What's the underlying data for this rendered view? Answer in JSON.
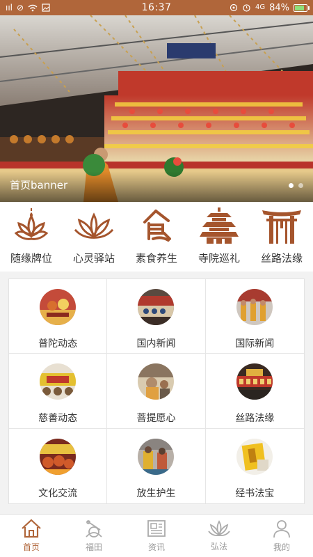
{
  "status_bar": {
    "time": "16:37",
    "signal": "ııl",
    "battery_percent": "84%",
    "battery_level": 0.84,
    "network": "4G"
  },
  "banner": {
    "title": "首页banner",
    "slide_count": 2,
    "active_slide": 0
  },
  "quick_nav": [
    {
      "label": "随缘牌位",
      "icon": "lotus-flame-icon"
    },
    {
      "label": "心灵驿站",
      "icon": "lotus-icon"
    },
    {
      "label": "素食养生",
      "icon": "food-character-icon"
    },
    {
      "label": "寺院巡礼",
      "icon": "pagoda-icon"
    },
    {
      "label": "丝路法缘",
      "icon": "temple-gate-icon"
    }
  ],
  "grid": [
    {
      "label": "普陀动态"
    },
    {
      "label": "国内新闻"
    },
    {
      "label": "国际新闻"
    },
    {
      "label": "慈善动态"
    },
    {
      "label": "菩提愿心"
    },
    {
      "label": "丝路法缘"
    },
    {
      "label": "文化交流"
    },
    {
      "label": "放生护生"
    },
    {
      "label": "经书法宝"
    }
  ],
  "tabs": [
    {
      "label": "首页",
      "icon": "home-icon",
      "active": true
    },
    {
      "label": "福田",
      "icon": "field-icon",
      "active": false
    },
    {
      "label": "资讯",
      "icon": "news-icon",
      "active": false
    },
    {
      "label": "弘法",
      "icon": "lotus-icon",
      "active": false
    },
    {
      "label": "我的",
      "icon": "user-icon",
      "active": false
    }
  ],
  "colors": {
    "accent": "#b0663a",
    "icon_brown": "#a5552d",
    "inactive": "#999999"
  }
}
